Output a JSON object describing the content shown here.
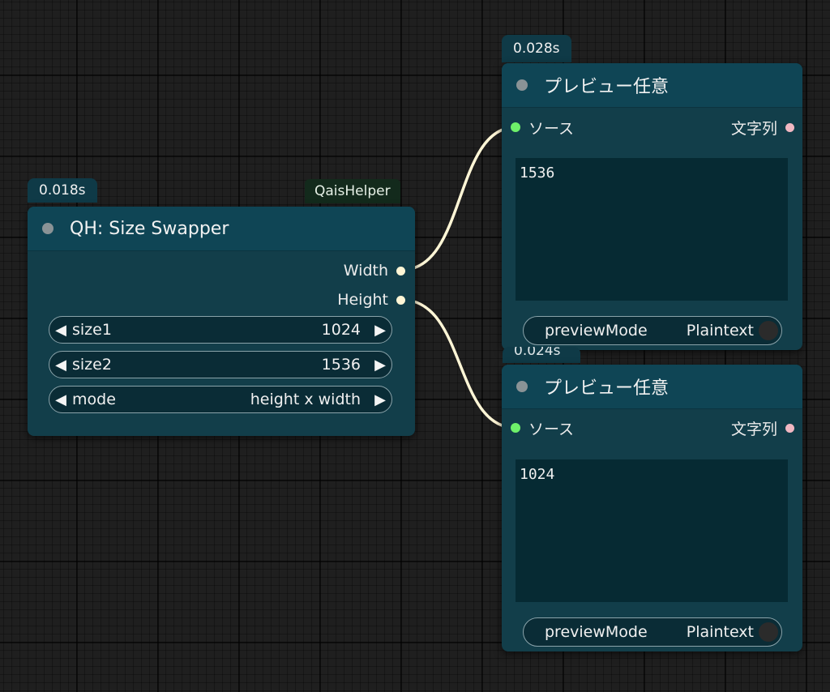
{
  "node_size_swapper": {
    "time_badge": "0.018s",
    "source_badge": "QaisHelper",
    "title": "QH: Size Swapper",
    "outputs": [
      {
        "label": "Width"
      },
      {
        "label": "Height"
      }
    ],
    "widgets": [
      {
        "label": "size1",
        "value": "1024"
      },
      {
        "label": "size2",
        "value": "1536"
      },
      {
        "label": "mode",
        "value": "height x width"
      }
    ]
  },
  "node_preview_1": {
    "time_badge": "0.028s",
    "title": "プレビュー任意",
    "input_label": "ソース",
    "output_label": "文字列",
    "text": "1536",
    "preview_mode_label": "previewMode",
    "preview_mode_value": "Plaintext"
  },
  "node_preview_2": {
    "time_badge": "0.024s",
    "title": "プレビュー任意",
    "input_label": "ソース",
    "output_label": "文字列",
    "text": "1024",
    "preview_mode_label": "previewMode",
    "preview_mode_value": "Plaintext"
  },
  "icons": {
    "left_arrow": "◀",
    "right_arrow": "▶"
  },
  "colors": {
    "canvas_bg": "#1f1f1f",
    "node_body": "#123e4a",
    "node_header": "#0f4555",
    "link": "#fff6d6",
    "input_dot": "#6ef06a",
    "string_output_dot": "#f1b7c2"
  }
}
